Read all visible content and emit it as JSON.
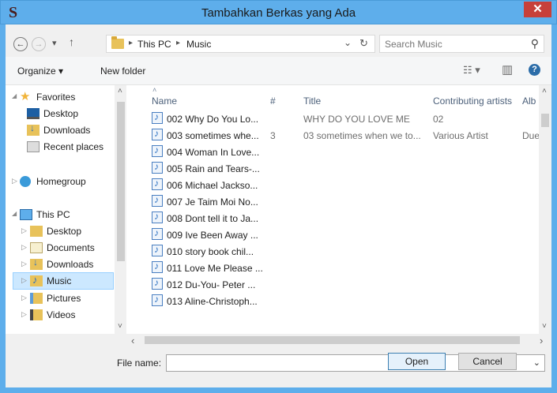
{
  "window": {
    "title": "Tambahkan Berkas yang Ada",
    "app_icon_letter": "S",
    "close_glyph": "✕"
  },
  "address": {
    "back_glyph": "←",
    "forward_glyph": "→",
    "recent_glyph": "▾",
    "up_glyph": "↑",
    "path": [
      "This PC",
      "Music"
    ],
    "separator": "▸",
    "dropdown_glyph": "⌄",
    "refresh_glyph": "↻",
    "search_placeholder": "Search Music",
    "search_glyph": "⚲"
  },
  "toolbar": {
    "organize_label": "Organize ▾",
    "new_folder_label": "New folder",
    "view_glyph": "☷ ▾",
    "preview_glyph": "▥",
    "help_glyph": "?"
  },
  "nav": {
    "favorites_label": "Favorites",
    "favorites_items": [
      "Desktop",
      "Downloads",
      "Recent places"
    ],
    "homegroup_label": "Homegroup",
    "thispc_label": "This PC",
    "thispc_items": [
      "Desktop",
      "Documents",
      "Downloads",
      "Music",
      "Pictures",
      "Videos"
    ],
    "selected": "Music",
    "expanded_glyph": "◢",
    "collapsed_glyph": "▷"
  },
  "list": {
    "columns": [
      "Name",
      "#",
      "Title",
      "Contributing artists",
      "Alb"
    ],
    "sort_glyph": "˄",
    "rows": [
      {
        "name": "002 Why Do You Lo...",
        "num": "",
        "title": "WHY DO YOU LOVE ME",
        "artist": "02",
        "album": ""
      },
      {
        "name": "003 sometimes whe...",
        "num": "3",
        "title": "03 sometimes when we to...",
        "artist": "Various Artist",
        "album": "Due"
      },
      {
        "name": "004 Woman In Love...",
        "num": "",
        "title": "",
        "artist": "",
        "album": ""
      },
      {
        "name": "005 Rain and Tears-...",
        "num": "",
        "title": "",
        "artist": "",
        "album": ""
      },
      {
        "name": "006 Michael Jackso...",
        "num": "",
        "title": "",
        "artist": "",
        "album": ""
      },
      {
        "name": "007 Je Taim Moi No...",
        "num": "",
        "title": "",
        "artist": "",
        "album": ""
      },
      {
        "name": "008 Dont tell it to Ja...",
        "num": "",
        "title": "",
        "artist": "",
        "album": ""
      },
      {
        "name": "009 Ive Been Away ...",
        "num": "",
        "title": "",
        "artist": "",
        "album": ""
      },
      {
        "name": "010 story book chil...",
        "num": "",
        "title": "",
        "artist": "",
        "album": ""
      },
      {
        "name": "011 Love Me Please ...",
        "num": "",
        "title": "",
        "artist": "",
        "album": ""
      },
      {
        "name": "012 Du-You- Peter ...",
        "num": "",
        "title": "",
        "artist": "",
        "album": ""
      },
      {
        "name": "013 Aline-Christoph...",
        "num": "",
        "title": "",
        "artist": "",
        "album": ""
      }
    ]
  },
  "scroll": {
    "up_glyph": "˄",
    "down_glyph": "˅",
    "left_glyph": "‹",
    "right_glyph": "›"
  },
  "bottom": {
    "file_name_label": "File name:",
    "file_name_value": "",
    "dropdown_glyph": "⌄",
    "open_label": "Open",
    "cancel_label": "Cancel"
  },
  "colors": {
    "titlebar": "#5eaeeb",
    "close": "#c7403a",
    "selection": "#cce8ff"
  }
}
